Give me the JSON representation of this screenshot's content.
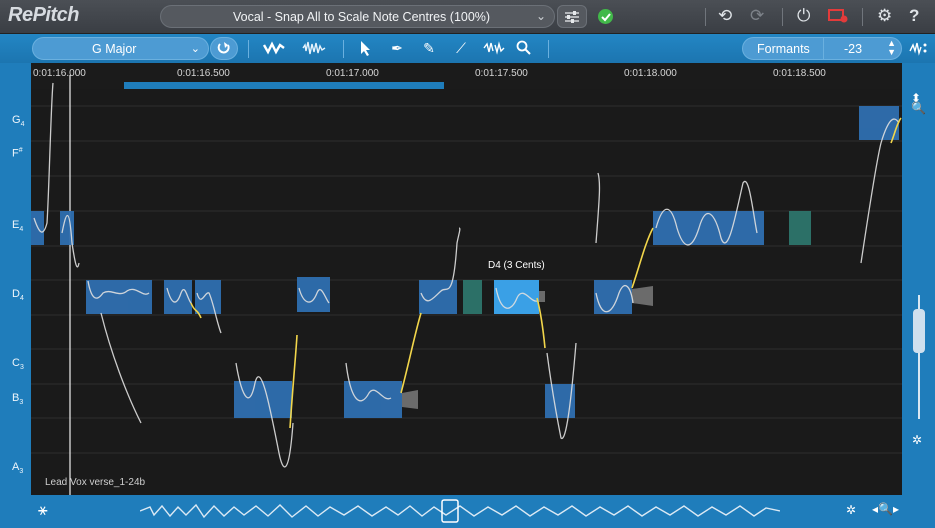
{
  "app": {
    "title": "RePitch",
    "preset": "Vocal - Snap All to Scale Note Centres (100%)"
  },
  "topbar": {
    "undo_icon": "undo-icon",
    "redo_icon": "redo-icon",
    "power_icon": "power-icon",
    "record_icon": "record-icon",
    "settings_icon": "gear-icon",
    "help_label": "?"
  },
  "toolbar": {
    "scale": "G Major",
    "formants_label": "Formants",
    "formants_value": "-23"
  },
  "ruler": {
    "ticks": [
      "0:01:16.000",
      "0:01:16.500",
      "0:01:17.000",
      "0:01:17.500",
      "0:01:18.000",
      "0:01:18.500"
    ]
  },
  "notes_axis": [
    {
      "name": "G",
      "sub": "4",
      "sup": ""
    },
    {
      "name": "F",
      "sub": "",
      "sup": "#"
    },
    {
      "name": "E",
      "sub": "4",
      "sup": ""
    },
    {
      "name": "D",
      "sub": "4",
      "sup": ""
    },
    {
      "name": "C",
      "sub": "3",
      "sup": ""
    },
    {
      "name": "B",
      "sub": "3",
      "sup": ""
    },
    {
      "name": "A",
      "sub": "3",
      "sup": ""
    }
  ],
  "editor": {
    "selected_note_tag": "D4 (3 Cents)",
    "track_name": "Lead Vox verse_1-24b"
  },
  "colors": {
    "accent": "#1f7dbb",
    "note_blob": "#2f6fb0",
    "note_selected": "#3aa0e6",
    "pitch_curve": "#e8e8e8",
    "transition_curve": "#f2d64b",
    "status_ok": "#42b94a"
  }
}
